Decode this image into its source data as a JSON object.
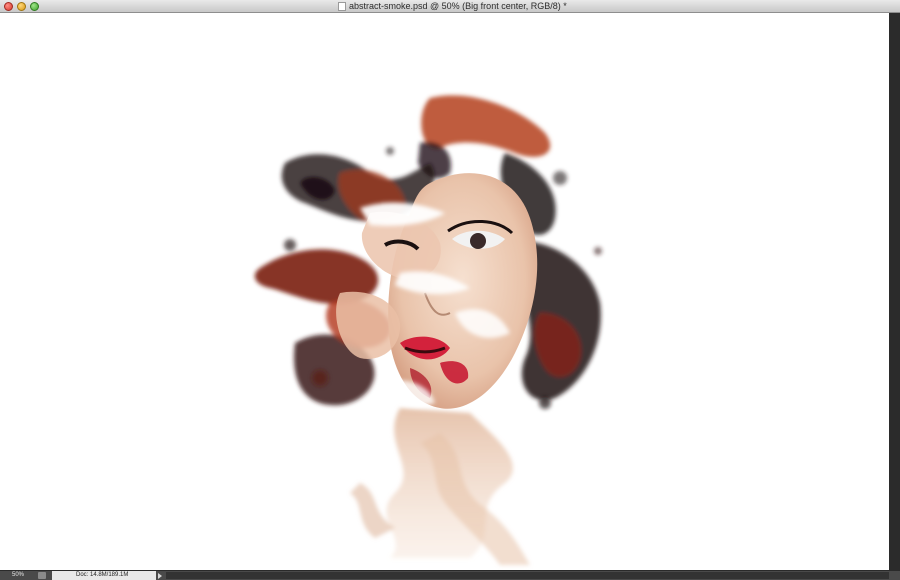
{
  "window": {
    "title": "abstract-smoke.psd @ 50% (Big front center, RGB/8) *",
    "doc_icon": "document-icon"
  },
  "status": {
    "zoom": "50%",
    "doc_info": "Doc: 14.8M/189.1M",
    "status_icon": "export-icon",
    "arrow_icon": "triangle-right-icon"
  },
  "colors": {
    "canvas_bg": "#ffffff",
    "chrome_dark": "#3a3a3a",
    "hair_red": "#a8321e",
    "smoke_dark": "#1c1416",
    "skin": "#f0d2bd",
    "lips": "#d81e3a"
  }
}
